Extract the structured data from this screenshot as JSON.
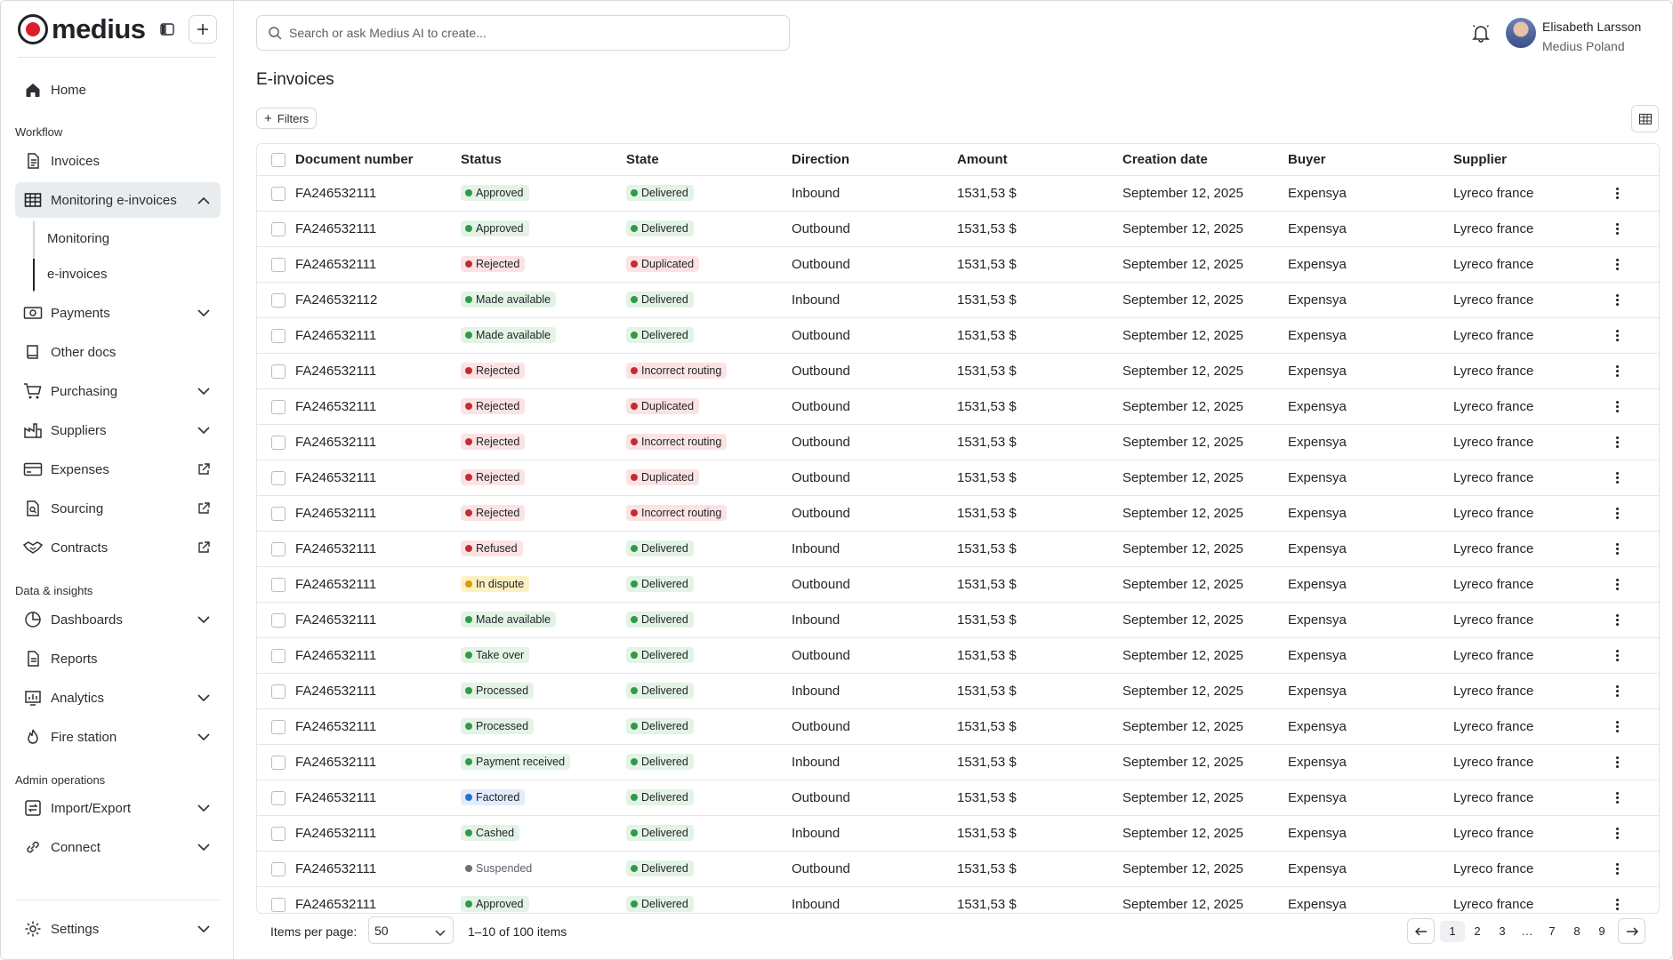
{
  "brand": {
    "name": "medius"
  },
  "search": {
    "placeholder": "Search or ask Medius AI to create..."
  },
  "user": {
    "name": "Elisabeth Larsson",
    "org": "Medius Poland"
  },
  "sidebar": {
    "home": {
      "label": "Home",
      "icon": "home-icon"
    },
    "sections": {
      "workflow": "Workflow",
      "data_insights": "Data & insights",
      "admin": "Admin operations"
    },
    "items": [
      {
        "label": "Invoices",
        "icon": "document-icon"
      },
      {
        "label": "Monitoring e-invoices",
        "icon": "table-icon",
        "active": true,
        "expanded": true
      },
      {
        "label": "Payments",
        "icon": "payment-icon"
      },
      {
        "label": "Other docs",
        "icon": "book-icon"
      },
      {
        "label": "Purchasing",
        "icon": "cart-icon"
      },
      {
        "label": "Suppliers",
        "icon": "factory-icon"
      },
      {
        "label": "Expenses",
        "icon": "card-icon"
      },
      {
        "label": "Sourcing",
        "icon": "search-document-icon"
      },
      {
        "label": "Contracts",
        "icon": "handshake-icon"
      },
      {
        "label": "Dashboards",
        "icon": "pie-chart-icon"
      },
      {
        "label": "Reports",
        "icon": "report-icon"
      },
      {
        "label": "Analytics",
        "icon": "analytics-icon"
      },
      {
        "label": "Fire station",
        "icon": "flame-icon"
      },
      {
        "label": "Import/Export",
        "icon": "import-export-icon"
      },
      {
        "label": "Connect",
        "icon": "link-icon"
      }
    ],
    "subitems": [
      "Monitoring",
      "e-invoices"
    ],
    "settings": {
      "label": "Settings",
      "icon": "gear-icon"
    }
  },
  "page": {
    "title": "E-invoices",
    "filters_label": "Filters"
  },
  "table": {
    "columns": [
      "Document number",
      "Status",
      "State",
      "Direction",
      "Amount",
      "Creation date",
      "Buyer",
      "Supplier"
    ],
    "rows": [
      {
        "doc": "FA246532111",
        "status": "Approved",
        "status_color": "green",
        "state": "Delivered",
        "state_color": "green",
        "direction": "Inbound",
        "amount": "1531,53 $",
        "date": "September 12, 2025",
        "buyer": "Expensya",
        "supplier": "Lyreco france"
      },
      {
        "doc": "FA246532111",
        "status": "Approved",
        "status_color": "green",
        "state": "Delivered",
        "state_color": "green",
        "direction": "Outbound",
        "amount": "1531,53 $",
        "date": "September 12, 2025",
        "buyer": "Expensya",
        "supplier": "Lyreco france"
      },
      {
        "doc": "FA246532111",
        "status": "Rejected",
        "status_color": "red",
        "state": "Duplicated",
        "state_color": "red",
        "direction": "Outbound",
        "amount": "1531,53 $",
        "date": "September 12, 2025",
        "buyer": "Expensya",
        "supplier": "Lyreco france"
      },
      {
        "doc": "FA246532112",
        "status": "Made available",
        "status_color": "green",
        "state": "Delivered",
        "state_color": "green",
        "direction": "Inbound",
        "amount": "1531,53 $",
        "date": "September 12, 2025",
        "buyer": "Expensya",
        "supplier": "Lyreco france"
      },
      {
        "doc": "FA246532111",
        "status": "Made available",
        "status_color": "green",
        "state": "Delivered",
        "state_color": "green",
        "direction": "Outbound",
        "amount": "1531,53 $",
        "date": "September 12, 2025",
        "buyer": "Expensya",
        "supplier": "Lyreco france"
      },
      {
        "doc": "FA246532111",
        "status": "Rejected",
        "status_color": "red",
        "state": "Incorrect routing",
        "state_color": "red",
        "direction": "Outbound",
        "amount": "1531,53 $",
        "date": "September 12, 2025",
        "buyer": "Expensya",
        "supplier": "Lyreco france"
      },
      {
        "doc": "FA246532111",
        "status": "Rejected",
        "status_color": "red",
        "state": "Duplicated",
        "state_color": "red",
        "direction": "Outbound",
        "amount": "1531,53 $",
        "date": "September 12, 2025",
        "buyer": "Expensya",
        "supplier": "Lyreco france"
      },
      {
        "doc": "FA246532111",
        "status": "Rejected",
        "status_color": "red",
        "state": "Incorrect routing",
        "state_color": "red",
        "direction": "Outbound",
        "amount": "1531,53 $",
        "date": "September 12, 2025",
        "buyer": "Expensya",
        "supplier": "Lyreco france"
      },
      {
        "doc": "FA246532111",
        "status": "Rejected",
        "status_color": "red",
        "state": "Duplicated",
        "state_color": "red",
        "direction": "Outbound",
        "amount": "1531,53 $",
        "date": "September 12, 2025",
        "buyer": "Expensya",
        "supplier": "Lyreco france"
      },
      {
        "doc": "FA246532111",
        "status": "Rejected",
        "status_color": "red",
        "state": "Incorrect routing",
        "state_color": "red",
        "direction": "Outbound",
        "amount": "1531,53 $",
        "date": "September 12, 2025",
        "buyer": "Expensya",
        "supplier": "Lyreco france"
      },
      {
        "doc": "FA246532111",
        "status": "Refused",
        "status_color": "red",
        "state": "Delivered",
        "state_color": "green",
        "direction": "Inbound",
        "amount": "1531,53 $",
        "date": "September 12, 2025",
        "buyer": "Expensya",
        "supplier": "Lyreco france"
      },
      {
        "doc": "FA246532111",
        "status": "In dispute",
        "status_color": "yellow",
        "state": "Delivered",
        "state_color": "green",
        "direction": "Outbound",
        "amount": "1531,53 $",
        "date": "September 12, 2025",
        "buyer": "Expensya",
        "supplier": "Lyreco france"
      },
      {
        "doc": "FA246532111",
        "status": "Made available",
        "status_color": "green",
        "state": "Delivered",
        "state_color": "green",
        "direction": "Inbound",
        "amount": "1531,53 $",
        "date": "September 12, 2025",
        "buyer": "Expensya",
        "supplier": "Lyreco france"
      },
      {
        "doc": "FA246532111",
        "status": "Take over",
        "status_color": "green",
        "state": "Delivered",
        "state_color": "green",
        "direction": "Outbound",
        "amount": "1531,53 $",
        "date": "September 12, 2025",
        "buyer": "Expensya",
        "supplier": "Lyreco france"
      },
      {
        "doc": "FA246532111",
        "status": "Processed",
        "status_color": "green",
        "state": "Delivered",
        "state_color": "green",
        "direction": "Inbound",
        "amount": "1531,53 $",
        "date": "September 12, 2025",
        "buyer": "Expensya",
        "supplier": "Lyreco france"
      },
      {
        "doc": "FA246532111",
        "status": "Processed",
        "status_color": "green",
        "state": "Delivered",
        "state_color": "green",
        "direction": "Outbound",
        "amount": "1531,53 $",
        "date": "September 12, 2025",
        "buyer": "Expensya",
        "supplier": "Lyreco france"
      },
      {
        "doc": "FA246532111",
        "status": "Payment received",
        "status_color": "green",
        "state": "Delivered",
        "state_color": "green",
        "direction": "Inbound",
        "amount": "1531,53 $",
        "date": "September 12, 2025",
        "buyer": "Expensya",
        "supplier": "Lyreco france"
      },
      {
        "doc": "FA246532111",
        "status": "Factored",
        "status_color": "blue",
        "state": "Delivered",
        "state_color": "green",
        "direction": "Outbound",
        "amount": "1531,53 $",
        "date": "September 12, 2025",
        "buyer": "Expensya",
        "supplier": "Lyreco france"
      },
      {
        "doc": "FA246532111",
        "status": "Cashed",
        "status_color": "green",
        "state": "Delivered",
        "state_color": "green",
        "direction": "Inbound",
        "amount": "1531,53 $",
        "date": "September 12, 2025",
        "buyer": "Expensya",
        "supplier": "Lyreco france"
      },
      {
        "doc": "FA246532111",
        "status": "Suspended",
        "status_color": "gray",
        "state": "Delivered",
        "state_color": "green",
        "direction": "Outbound",
        "amount": "1531,53 $",
        "date": "September 12, 2025",
        "buyer": "Expensya",
        "supplier": "Lyreco france"
      },
      {
        "doc": "FA246532111",
        "status": "Approved",
        "status_color": "green",
        "state": "Delivered",
        "state_color": "green",
        "direction": "Inbound",
        "amount": "1531,53 $",
        "date": "September 12, 2025",
        "buyer": "Expensya",
        "supplier": "Lyreco france"
      }
    ]
  },
  "footer": {
    "items_per_page_label": "Items per page:",
    "items_per_page_value": "50",
    "range": "1–10 of 100 items",
    "pages": [
      "1",
      "2",
      "3",
      "…",
      "7",
      "8",
      "9"
    ],
    "current_page": "1"
  }
}
